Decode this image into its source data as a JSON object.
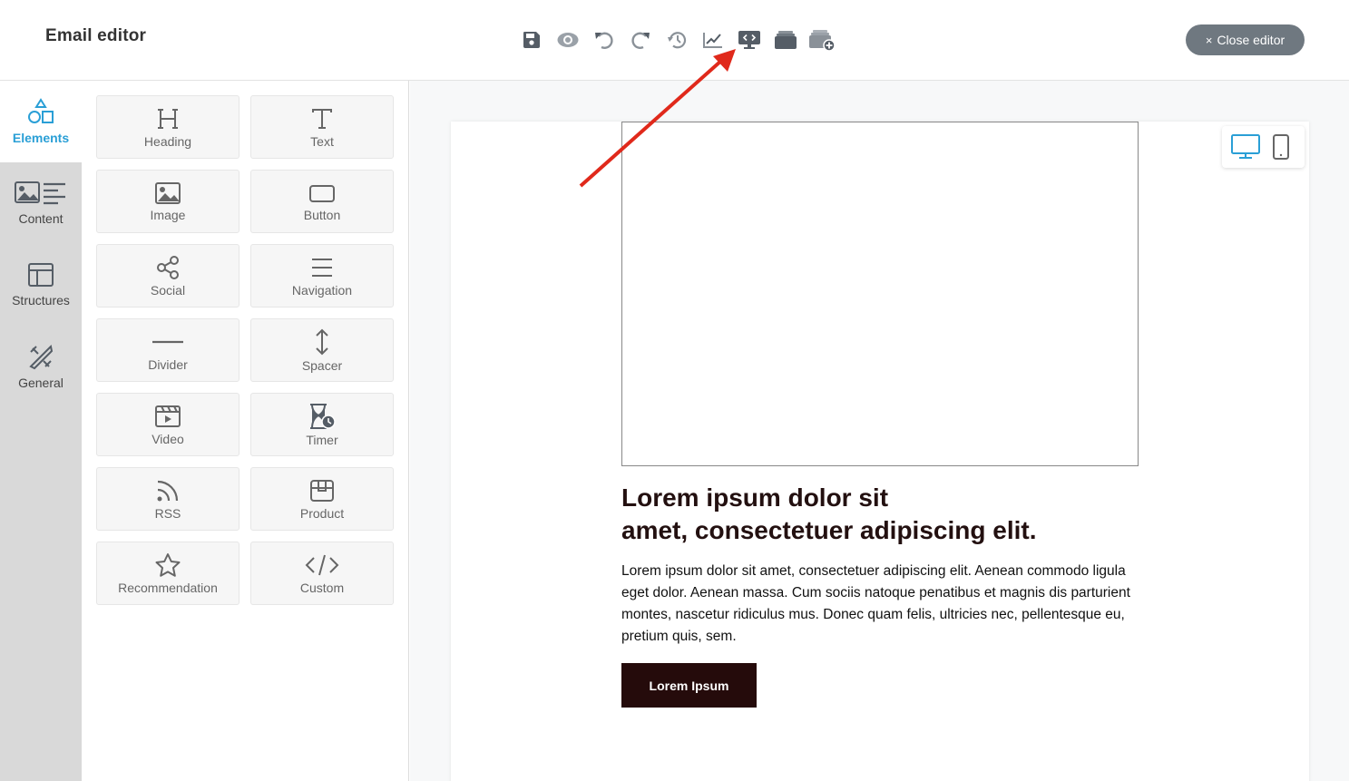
{
  "header": {
    "title": "Email editor",
    "close_label": "Close editor",
    "close_icon": "×",
    "toolbar": [
      {
        "name": "save-icon"
      },
      {
        "name": "preview-icon"
      },
      {
        "name": "undo-icon"
      },
      {
        "name": "redo-icon"
      },
      {
        "name": "history-icon"
      },
      {
        "name": "stats-icon"
      },
      {
        "name": "code-view-icon"
      },
      {
        "name": "template-icon"
      },
      {
        "name": "add-template-icon"
      }
    ]
  },
  "rail": {
    "items": [
      {
        "label": "Elements",
        "icon": "shapes-icon",
        "active": true
      },
      {
        "label": "Content",
        "icon": "content-icon",
        "active": false
      },
      {
        "label": "Structures",
        "icon": "layout-icon",
        "active": false
      },
      {
        "label": "General",
        "icon": "tools-icon",
        "active": false
      }
    ]
  },
  "palette": {
    "tiles": [
      {
        "label": "Heading",
        "icon": "heading-icon"
      },
      {
        "label": "Text",
        "icon": "text-icon"
      },
      {
        "label": "Image",
        "icon": "image-icon"
      },
      {
        "label": "Button",
        "icon": "button-icon"
      },
      {
        "label": "Social",
        "icon": "share-icon"
      },
      {
        "label": "Navigation",
        "icon": "menu-icon"
      },
      {
        "label": "Divider",
        "icon": "divider-icon"
      },
      {
        "label": "Spacer",
        "icon": "spacer-icon"
      },
      {
        "label": "Video",
        "icon": "video-icon"
      },
      {
        "label": "Timer",
        "icon": "timer-icon"
      },
      {
        "label": "RSS",
        "icon": "rss-icon"
      },
      {
        "label": "Product",
        "icon": "product-icon"
      },
      {
        "label": "Recommendation",
        "icon": "star-icon"
      },
      {
        "label": "Custom",
        "icon": "code-icon"
      }
    ]
  },
  "email": {
    "heading_line1": "Lorem ipsum dolor sit",
    "heading_line2": "amet, consectetuer adipiscing elit.",
    "body": "Lorem ipsum dolor sit amet, consectetuer adipiscing elit. Aenean commodo ligula eget dolor. Aenean massa. Cum sociis natoque penatibus et magnis dis parturient montes, nascetur ridiculus mus. Donec quam felis, ultricies nec, pellentesque eu, pretium quis, sem.",
    "button_label": "Lorem Ipsum"
  },
  "colors": {
    "accent": "#2a9fd6",
    "close_button": "#6f7880",
    "cta_background": "#250b0b",
    "annotation_arrow": "#e0291b",
    "rail_background": "#d9d9d9"
  }
}
